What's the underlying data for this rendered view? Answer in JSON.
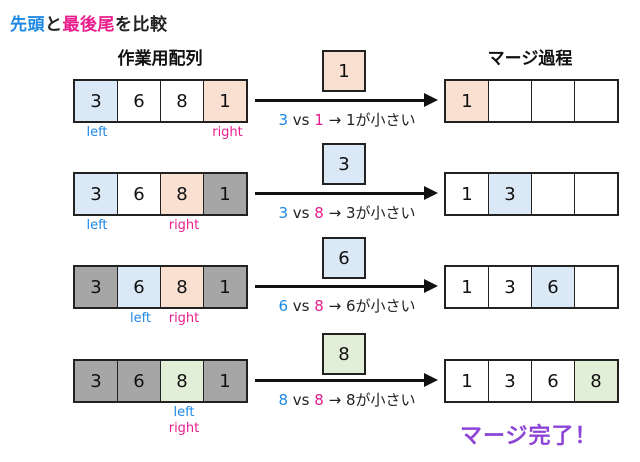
{
  "title": {
    "part1": "先頭",
    "part2": "と",
    "part3": "最後尾",
    "part4": "を比較"
  },
  "headers": {
    "left": "作業用配列",
    "right": "マージ過程"
  },
  "rows": [
    {
      "work": [
        {
          "v": "3",
          "bg": "b"
        },
        {
          "v": "6",
          "bg": "w"
        },
        {
          "v": "8",
          "bg": "w"
        },
        {
          "v": "1",
          "bg": "p"
        }
      ],
      "labels": {
        "left": "left",
        "right": "right"
      },
      "pick": "1",
      "pick_bg": "p",
      "cmp": {
        "a": "3",
        "vs": "vs",
        "b": "1",
        "arrow": "→",
        "res": "1が小さい"
      },
      "merge": [
        {
          "v": "1",
          "bg": "p"
        },
        {
          "v": "",
          "bg": "w"
        },
        {
          "v": "",
          "bg": "w"
        },
        {
          "v": "",
          "bg": "w"
        }
      ]
    },
    {
      "work": [
        {
          "v": "3",
          "bg": "b"
        },
        {
          "v": "6",
          "bg": "w"
        },
        {
          "v": "8",
          "bg": "p"
        },
        {
          "v": "1",
          "bg": "g"
        }
      ],
      "labels": {
        "left": "left",
        "right": "right"
      },
      "pick": "3",
      "pick_bg": "b",
      "cmp": {
        "a": "3",
        "vs": "vs",
        "b": "8",
        "arrow": "→",
        "res": "3が小さい"
      },
      "merge": [
        {
          "v": "1",
          "bg": "w"
        },
        {
          "v": "3",
          "bg": "b"
        },
        {
          "v": "",
          "bg": "w"
        },
        {
          "v": "",
          "bg": "w"
        }
      ]
    },
    {
      "work": [
        {
          "v": "3",
          "bg": "g"
        },
        {
          "v": "6",
          "bg": "b"
        },
        {
          "v": "8",
          "bg": "p"
        },
        {
          "v": "1",
          "bg": "g"
        }
      ],
      "labels": {
        "left": "left",
        "right": "right"
      },
      "pick": "6",
      "pick_bg": "b",
      "cmp": {
        "a": "6",
        "vs": "vs",
        "b": "8",
        "arrow": "→",
        "res": "6が小さい"
      },
      "merge": [
        {
          "v": "1",
          "bg": "w"
        },
        {
          "v": "3",
          "bg": "w"
        },
        {
          "v": "6",
          "bg": "b"
        },
        {
          "v": "",
          "bg": "w"
        }
      ]
    },
    {
      "work": [
        {
          "v": "3",
          "bg": "g"
        },
        {
          "v": "6",
          "bg": "g"
        },
        {
          "v": "8",
          "bg": "gr"
        },
        {
          "v": "1",
          "bg": "g"
        }
      ],
      "labels": {
        "left": "left",
        "right": "right"
      },
      "pick": "8",
      "pick_bg": "gr",
      "cmp": {
        "a": "8",
        "vs": "vs",
        "b": "8",
        "arrow": "→",
        "res": "8が小さい"
      },
      "merge": [
        {
          "v": "1",
          "bg": "w"
        },
        {
          "v": "3",
          "bg": "w"
        },
        {
          "v": "6",
          "bg": "w"
        },
        {
          "v": "8",
          "bg": "gr"
        }
      ]
    }
  ],
  "done": "マージ完了！",
  "colors": {
    "left_label": "#1e88e5",
    "right_label": "#e91e8c",
    "done": "#8e44d6"
  }
}
